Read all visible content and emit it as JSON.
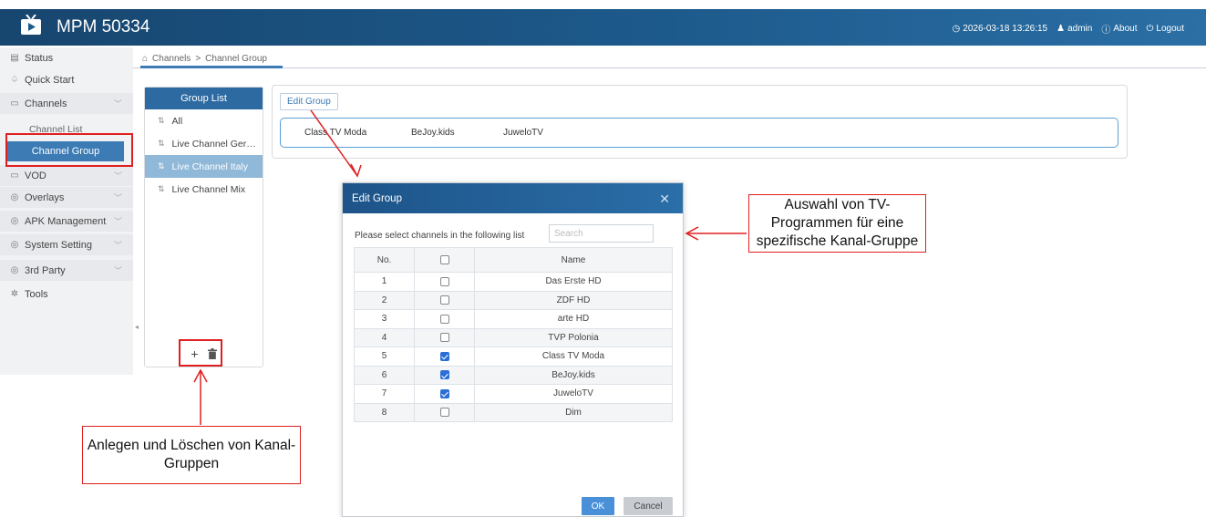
{
  "header": {
    "title": "MPM 50334",
    "datetime": "2026-03-18 13:26:15",
    "user": "admin",
    "about": "About",
    "logout": "Logout"
  },
  "sidebar": {
    "status": "Status",
    "quick_start": "Quick Start",
    "channels": "Channels",
    "channel_list": "Channel List",
    "channel_group": "Channel Group",
    "vod": "VOD",
    "overlays": "Overlays",
    "apk_management": "APK Management",
    "system_setting": "System Setting",
    "third_party": "3rd Party",
    "tools": "Tools"
  },
  "breadcrumb": {
    "root": "Channels",
    "separator": ">",
    "current": "Channel Group"
  },
  "group_list": {
    "title": "Group List",
    "items": [
      "All",
      "Live Channel Ger…",
      "Live Channel Italy",
      "Live Channel Mix"
    ],
    "add_label": "+"
  },
  "edit_group": {
    "button_label": "Edit Group",
    "selected_channels": [
      "Class TV Moda",
      "BeJoy.kids",
      "JuweloTV"
    ]
  },
  "modal": {
    "title": "Edit Group",
    "prompt": "Please select channels in the following list",
    "search_placeholder": "Search",
    "col_no": "No.",
    "col_name": "Name",
    "rows": [
      {
        "no": "1",
        "name": "Das Erste HD"
      },
      {
        "no": "2",
        "name": "ZDF HD"
      },
      {
        "no": "3",
        "name": "arte HD"
      },
      {
        "no": "4",
        "name": "TVP Polonia"
      },
      {
        "no": "5",
        "name": "Class TV Moda"
      },
      {
        "no": "6",
        "name": "BeJoy.kids"
      },
      {
        "no": "7",
        "name": "JuweloTV"
      },
      {
        "no": "8",
        "name": "Dim"
      }
    ],
    "ok": "OK",
    "cancel": "Cancel"
  },
  "annotations": {
    "right_callout": "Auswahl von TV-Programmen für eine spezifische Kanal-Gruppe",
    "bottom_callout": "Anlegen und Löschen von Kanal-Gruppen"
  },
  "colors": {
    "header": "#1d5a8c",
    "accent": "#3c7bb4",
    "annotation": "#e02020"
  }
}
